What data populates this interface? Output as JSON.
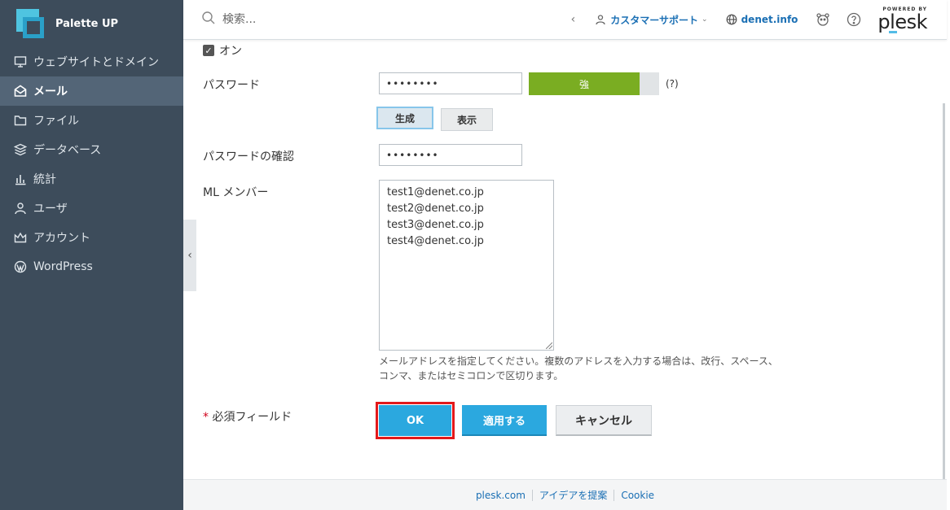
{
  "brand": {
    "name": "Palette UP"
  },
  "sidebar": {
    "items": [
      {
        "label": "ウェブサイトとドメイン",
        "icon": "monitor-icon"
      },
      {
        "label": "メール",
        "icon": "mail-icon",
        "active": true
      },
      {
        "label": "ファイル",
        "icon": "folder-icon"
      },
      {
        "label": "データベース",
        "icon": "database-icon"
      },
      {
        "label": "統計",
        "icon": "stats-icon"
      },
      {
        "label": "ユーザ",
        "icon": "user-icon"
      },
      {
        "label": "アカウント",
        "icon": "crown-icon"
      },
      {
        "label": "WordPress",
        "icon": "wordpress-icon"
      }
    ]
  },
  "header": {
    "search_placeholder": "検索...",
    "support_label": "カスタマーサポート",
    "domain_label": "denet.info",
    "powered_by": "POWERED BY",
    "logo_text": "plesk"
  },
  "form": {
    "checkbox_label": "オン",
    "password_label": "パスワード",
    "password_value": "••••••••",
    "strength_label": "強",
    "strength_fraction": 0.85,
    "help_label": "(?)",
    "generate_label": "生成",
    "show_label": "表示",
    "confirm_label": "パスワードの確認",
    "confirm_value": "••••••••",
    "members_label": "ML メンバー",
    "members": [
      "test1@denet.co.jp",
      "test2@denet.co.jp",
      "test3@denet.co.jp",
      "test4@denet.co.jp"
    ],
    "hint_line1": "メールアドレスを指定してください。複数のアドレスを入力する場合は、改行、スペース、",
    "hint_line2": "コンマ、またはセミコロンで区切ります。",
    "required_star": "*",
    "required_label": "必須フィールド",
    "ok_label": "OK",
    "apply_label": "適用する",
    "cancel_label": "キャンセル"
  },
  "footer": {
    "links": [
      "plesk.com",
      "アイデアを提案",
      "Cookie"
    ]
  },
  "colors": {
    "sidebar_bg": "#3d4c5b",
    "accent": "#2ba8df",
    "strength": "#7aad22",
    "highlight": "#e3191b"
  }
}
